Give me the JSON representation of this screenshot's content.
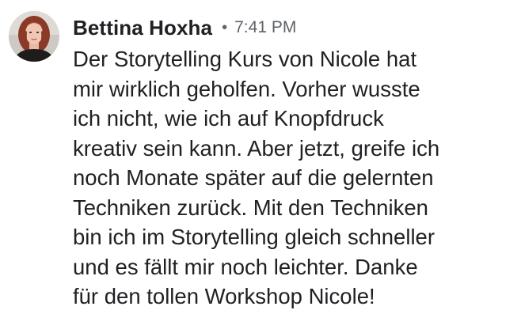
{
  "comment": {
    "author": "Bettina Hoxha",
    "separator": "•",
    "timestamp": "7:41 PM",
    "lines": [
      "Der Storytelling Kurs von Nicole hat",
      "mir wirklich geholfen. Vorher wusste",
      "ich nicht, wie ich auf Knopfdruck",
      "kreativ sein kann. Aber jetzt, greife ich",
      "noch Monate später auf die gelernten",
      "Techniken zurück. Mit den Techniken",
      "bin ich im Storytelling gleich schneller",
      "und es fällt mir noch leichter. Danke",
      "für den tollen Workshop Nicole!"
    ]
  },
  "colors": {
    "text": "#202124",
    "meta": "#5f6368",
    "background": "#ffffff"
  }
}
